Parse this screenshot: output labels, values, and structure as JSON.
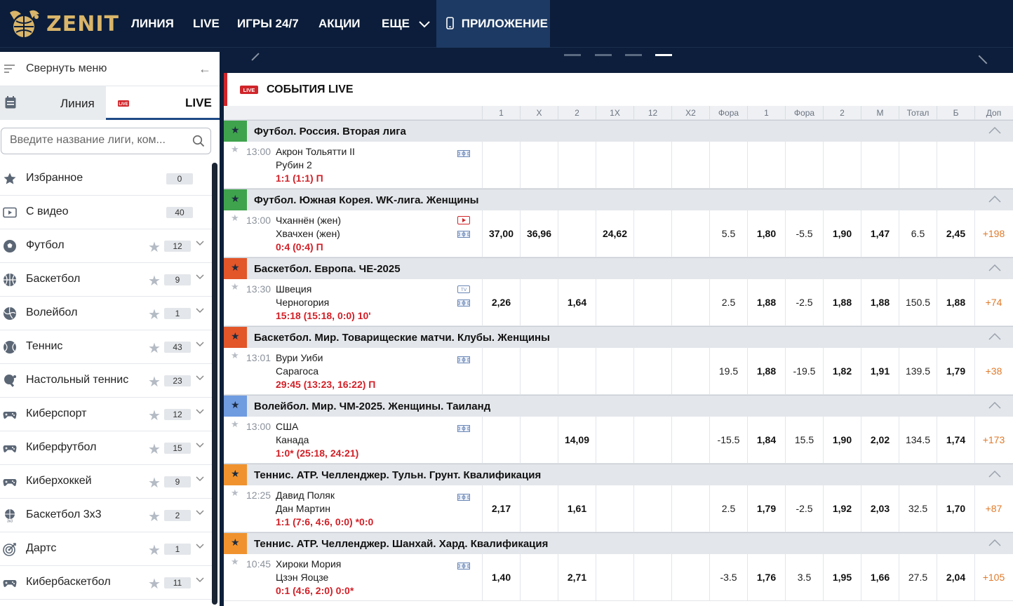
{
  "nav": {
    "brand": "ZENIT",
    "items": [
      "ЛИНИЯ",
      "LIVE",
      "ИГРЫ 24/7",
      "АКЦИИ",
      "ЕЩЕ"
    ],
    "app": "ПРИЛОЖЕНИЕ"
  },
  "sidebar": {
    "collapse": "Свернуть меню",
    "tab_line": "Линия",
    "tab_live": "LIVE",
    "live_badge": "LIVE",
    "search_placeholder": "Введите название лиги, ком...",
    "items": [
      {
        "label": "Избранное",
        "count": "0",
        "icon": "star-icon"
      },
      {
        "label": "С видео",
        "count": "40",
        "icon": "video-icon"
      },
      {
        "label": "Футбол",
        "count": "12",
        "icon": "football-icon"
      },
      {
        "label": "Баскетбол",
        "count": "9",
        "icon": "basketball-icon"
      },
      {
        "label": "Волейбол",
        "count": "1",
        "icon": "volleyball-icon"
      },
      {
        "label": "Теннис",
        "count": "43",
        "icon": "tennis-icon"
      },
      {
        "label": "Настольный теннис",
        "count": "23",
        "icon": "table-tennis-icon"
      },
      {
        "label": "Киберспорт",
        "count": "12",
        "icon": "gamepad-icon"
      },
      {
        "label": "Киберфутбол",
        "count": "15",
        "icon": "gamepad-icon"
      },
      {
        "label": "Киберхоккей",
        "count": "9",
        "icon": "gamepad-icon"
      },
      {
        "label": "Баскетбол 3х3",
        "count": "2",
        "icon": "basketball-3x3-icon"
      },
      {
        "label": "Дартс",
        "count": "1",
        "icon": "darts-icon"
      },
      {
        "label": "Кибербаскетбол",
        "count": "11",
        "icon": "gamepad-icon"
      }
    ]
  },
  "main": {
    "badge": "LIVE",
    "title": "СОБЫТИЯ LIVE",
    "columns": [
      "1",
      "X",
      "2",
      "1X",
      "12",
      "X2",
      "Фора",
      "1",
      "Фора",
      "2",
      "М",
      "Тотал",
      "Б",
      "Доп"
    ],
    "leagues": [
      {
        "name": "Футбол. Россия. Вторая лига",
        "color": "#3fa34d",
        "event": {
          "time": "13:00",
          "team1": "Акрон Тольятти II",
          "team2": "Рубин 2",
          "score": "1:1 (1:1) П",
          "icons": [
            "field-icon"
          ],
          "odds": [
            "",
            "",
            "",
            "",
            "",
            "",
            "",
            "",
            "",
            "",
            "",
            "",
            "",
            ""
          ]
        }
      },
      {
        "name": "Футбол. Южная Корея. WK-лига. Женщины",
        "color": "#3fa34d",
        "event": {
          "time": "13:00",
          "team1": "Чханнён (жен)",
          "team2": "Хвачхен (жен)",
          "score": "0:4 (0:4) П",
          "icons": [
            "video-icon",
            "field-icon"
          ],
          "odds": [
            "37,00",
            "36,96",
            "",
            "24,62",
            "",
            "",
            "5.5",
            "1,80",
            "-5.5",
            "1,90",
            "1,47",
            "6.5",
            "2,45",
            "+198"
          ]
        }
      },
      {
        "name": "Баскетбол. Европа. ЧЕ-2025",
        "color": "#e2562a",
        "event": {
          "time": "13:30",
          "team1": "Швеция",
          "team2": "Черногория",
          "score": "15:18 (15:18, 0:0) 10'",
          "icons": [
            "tv-icon",
            "field-icon"
          ],
          "odds": [
            "2,26",
            "",
            "1,64",
            "",
            "",
            "",
            "2.5",
            "1,88",
            "-2.5",
            "1,88",
            "1,88",
            "150.5",
            "1,88",
            "+74"
          ]
        }
      },
      {
        "name": "Баскетбол. Мир. Товарищеские матчи. Клубы. Женщины",
        "color": "#e2562a",
        "event": {
          "time": "13:01",
          "team1": "Вури Уиби",
          "team2": "Сарагоса",
          "score": "29:45 (13:23, 16:22) П",
          "icons": [
            "field-icon"
          ],
          "odds": [
            "",
            "",
            "",
            "",
            "",
            "",
            "19.5",
            "1,88",
            "-19.5",
            "1,82",
            "1,91",
            "139.5",
            "1,79",
            "+38"
          ]
        }
      },
      {
        "name": "Волейбол. Мир. ЧМ-2025. Женщины. Таиланд",
        "color": "#6f9be0",
        "event": {
          "time": "13:00",
          "team1": "США",
          "team2": "Канада",
          "score": "1:0* (25:18, 24:21)",
          "icons": [
            "field-icon"
          ],
          "odds": [
            "",
            "",
            "14,09",
            "",
            "",
            "",
            "-15.5",
            "1,84",
            "15.5",
            "1,90",
            "2,02",
            "134.5",
            "1,74",
            "+173"
          ]
        }
      },
      {
        "name": "Теннис. ATP. Челленджер. Тульн. Грунт. Квалификация",
        "color": "#f0932e",
        "event": {
          "time": "12:25",
          "team1": "Давид Поляк",
          "team2": "Дан Мартин",
          "score": "1:1 (7:6, 4:6, 0:0) *0:0",
          "icons": [
            "field-icon"
          ],
          "odds": [
            "2,17",
            "",
            "1,61",
            "",
            "",
            "",
            "2.5",
            "1,79",
            "-2.5",
            "1,92",
            "2,03",
            "32.5",
            "1,70",
            "+87"
          ]
        }
      },
      {
        "name": "Теннис. ATP. Челленджер. Шанхай. Хард. Квалификация",
        "color": "#f0932e",
        "event": {
          "time": "10:45",
          "team1": "Хироки Мория",
          "team2": "Цзэн Яоцзе",
          "score": "0:1 (4:6, 2:0) 0:0*",
          "icons": [
            "field-icon"
          ],
          "odds": [
            "1,40",
            "",
            "2,71",
            "",
            "",
            "",
            "-3.5",
            "1,76",
            "3.5",
            "1,95",
            "1,66",
            "27.5",
            "2,04",
            "+105"
          ]
        }
      }
    ]
  },
  "colors": {
    "nav_bg": "#0b1d3a",
    "accent_live": "#d0252a",
    "brand_gold": "#d9b56a",
    "score_red": "#d21f26",
    "extra_orange": "#e07a2a"
  }
}
